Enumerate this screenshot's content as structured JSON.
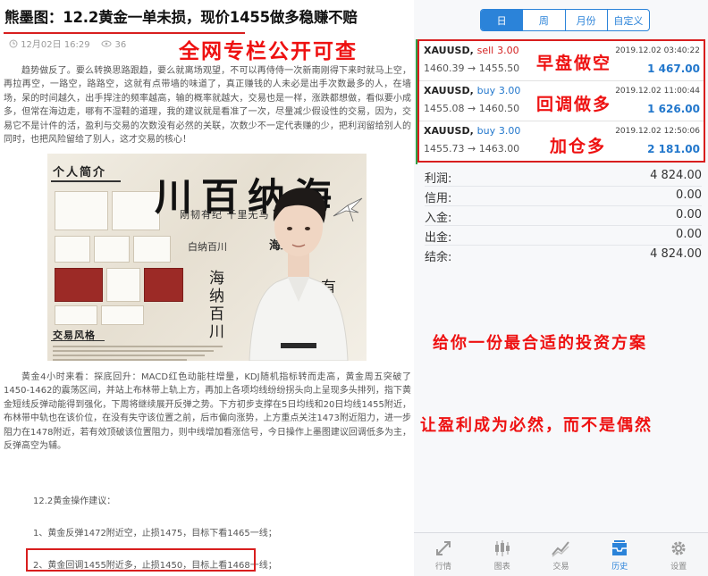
{
  "article": {
    "title": "熊墨图：12.2黄金一单未损，现价1455做多稳赚不赔",
    "date": "12月02日 16:29",
    "views": "36",
    "banner": "全网专栏公开可查",
    "para1": "趋势做反了。要么转换思路跟趋，要么就离场观望，不可以再侍侍一次新南刚得下来时就马上空，再拉再空，一路空，路路空，这就有点带墙的味道了，真正赚钱的人未必是出手次数最多的人，在墙场，呆的时间越久，出手捍注的频率越高，输的概率就越大，交易也是一样，涨跌都想做，看似要小成多，但常在海边走，哪有不湿鞋的道理，我的建议就是看准了一次，尽量减少假设性的交易，因为，交易它不是计件的活，盈利与交易的次数没有必然的关联，次数少不一定代表赚的少，把利润留给别人的同时，也把风险留给了别人，这才交易的核心！",
    "para2": "黄金4小时来看：探底回升：MACD红色动能柱增量，KDJ随机指标转而走高，黄金周五突破了1450-1462的震荡区间，并站上布林带上轨上方，再加上各项均线纷纷拐头向上呈现多头排列，指下黄金短线反弹动能得到强化，下周将继续展开反弹之势。下方初步支撑在5日均线和20日均线1455附近，布林带中轨也在该价位，在没有失守该位置之前，后市偏向涨势，上方重点关注1473附近阻力，进一步阻力在1478附近，若有效顶破该位置阻力，则中线增加看涨信号，今日操作上墨图建议回调低多为主，反弹高空为辅。",
    "suggestion_head": "12.2黄金操作建议：",
    "suggestion_1": "1、黄金反弹1472附近空，止损1475，目标下看1465一线；",
    "suggestion_2": "2、黄金回调1455附近多，止损1450，目标上看1468一线；"
  },
  "promo_image": {
    "tag_profile": "个人简介",
    "slogan": "川百纳海",
    "slogan_small": "刚韧有纪 千里无马 亚华川汇",
    "sub_a": "白纳百川",
    "sub_b": "海纳",
    "vert_1": "海纳百川",
    "vert_2": "有容乃大",
    "tag_style": "交易风格"
  },
  "tabs": [
    {
      "label": "日",
      "active": true
    },
    {
      "label": "周",
      "active": false
    },
    {
      "label": "月份",
      "active": false
    },
    {
      "label": "自定义",
      "active": false
    }
  ],
  "trades": [
    {
      "symbol": "XAUUSD,",
      "side": "sell",
      "lots": "3.00",
      "prices": "1460.39 → 1455.50",
      "time": "2019.12.02 03:40:22",
      "profit": "1 467.00",
      "note": "早盘做空"
    },
    {
      "symbol": "XAUUSD,",
      "side": "buy",
      "lots": "3.00",
      "prices": "1455.08 → 1460.50",
      "time": "2019.12.02 11:00:44",
      "profit": "1 626.00",
      "note": "回调做多"
    },
    {
      "symbol": "XAUUSD,",
      "side": "buy",
      "lots": "3.00",
      "prices": "1455.73 → 1463.00",
      "time": "2019.12.02 12:50:06",
      "profit": "2 181.00",
      "note": "加仓多"
    }
  ],
  "summary": [
    {
      "label": "利润:",
      "value": "4 824.00"
    },
    {
      "label": "信用:",
      "value": "0.00"
    },
    {
      "label": "入金:",
      "value": "0.00"
    },
    {
      "label": "出金:",
      "value": "0.00"
    },
    {
      "label": "结余:",
      "value": "4 824.00"
    }
  ],
  "promo_lines": {
    "a": "给你一份最合适的投资方案",
    "b": "让盈利成为必然，而不是偶然"
  },
  "nav": [
    {
      "label": "行情",
      "icon": "quotes-icon",
      "active": false
    },
    {
      "label": "图表",
      "icon": "chart-icon",
      "active": false
    },
    {
      "label": "交易",
      "icon": "trade-icon",
      "active": false
    },
    {
      "label": "历史",
      "icon": "history-icon",
      "active": true
    },
    {
      "label": "设置",
      "icon": "gear-icon",
      "active": false
    }
  ],
  "colors": {
    "accent": "#2b83d9",
    "red": "#d81e1e",
    "sell": "#d32020",
    "buy": "#2277cc"
  }
}
